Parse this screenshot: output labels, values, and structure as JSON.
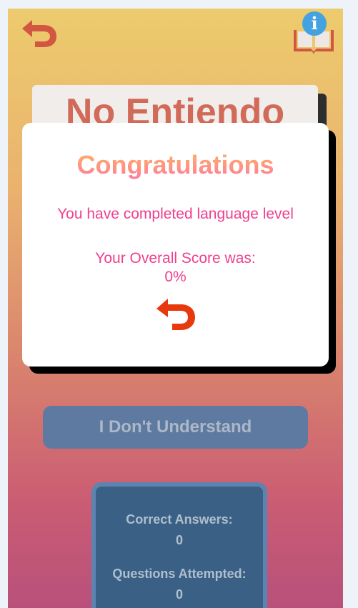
{
  "header": {
    "title": "No Entiendo"
  },
  "main": {
    "answer_button_label": "I Don't Understand",
    "stats": {
      "correct_label": "Correct Answers:",
      "correct_value": "0",
      "attempted_label": "Questions Attempted:",
      "attempted_value": "0"
    }
  },
  "modal": {
    "title": "Congratulations",
    "message": "You have completed language level",
    "score_label": "Your Overall Score was:",
    "score_value": "0%"
  },
  "icons": {
    "back": "back-arrow-icon",
    "info": "info-book-icon"
  },
  "colors": {
    "accent": "#ef3f8e",
    "back_arrow": "#e8380e",
    "info_blue": "#1a8ed8"
  }
}
